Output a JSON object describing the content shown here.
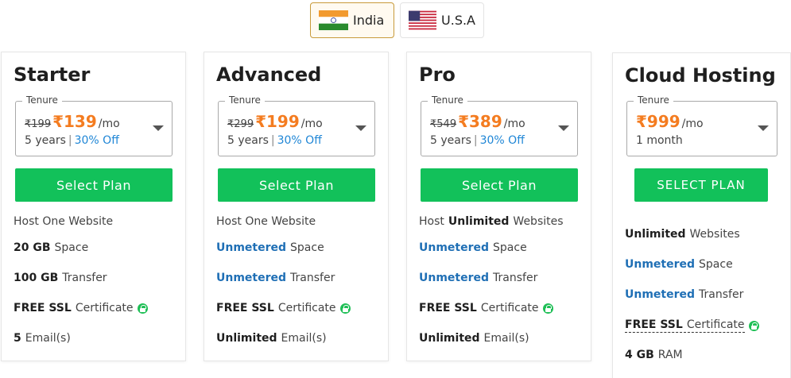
{
  "countries": [
    {
      "label": "India",
      "flag": "india-flag",
      "active": true
    },
    {
      "label": "U.S.A",
      "flag": "usa-flag",
      "active": false
    }
  ],
  "colors": {
    "accent_orange": "#f47c20",
    "button_green": "#12c15a",
    "link_blue": "#1f6fb5",
    "active_border": "#c89a3a"
  },
  "plans": [
    {
      "title": "Starter",
      "tenure_label": "Tenure",
      "old_price": "₹199",
      "new_price": "₹139",
      "per": "/mo",
      "term": "5 years",
      "discount": "30% Off",
      "button": "Select Plan",
      "features": [
        {
          "pre": "Host One Website",
          "strong": "",
          "post": ""
        },
        {
          "pre": "",
          "strong": "20 GB",
          "post": "Space"
        },
        {
          "pre": "",
          "strong": "100 GB",
          "post": "Transfer"
        },
        {
          "pre": "",
          "strong": "FREE SSL",
          "post": "Certificate"
        },
        {
          "pre": "",
          "strong": "5",
          "post": "Email(s)"
        }
      ]
    },
    {
      "title": "Advanced",
      "tenure_label": "Tenure",
      "old_price": "₹299",
      "new_price": "₹199",
      "per": "/mo",
      "term": "5 years",
      "discount": "30% Off",
      "button": "Select Plan",
      "features": [
        {
          "pre": "Host One Website",
          "strong": "",
          "post": ""
        },
        {
          "pre": "",
          "strong": "Unmetered",
          "post": "Space"
        },
        {
          "pre": "",
          "strong": "Unmetered",
          "post": "Transfer"
        },
        {
          "pre": "",
          "strong": "FREE SSL",
          "post": "Certificate"
        },
        {
          "pre": "",
          "strong": "Unlimited",
          "post": "Email(s)"
        }
      ]
    },
    {
      "title": "Pro",
      "tenure_label": "Tenure",
      "old_price": "₹549",
      "new_price": "₹389",
      "per": "/mo",
      "term": "5 years",
      "discount": "30% Off",
      "button": "Select Plan",
      "features": [
        {
          "pre": "Host",
          "strong": "Unlimited",
          "post": "Websites"
        },
        {
          "pre": "",
          "strong": "Unmetered",
          "post": "Space"
        },
        {
          "pre": "",
          "strong": "Unmetered",
          "post": "Transfer"
        },
        {
          "pre": "",
          "strong": "FREE SSL",
          "post": "Certificate"
        },
        {
          "pre": "",
          "strong": "Unlimited",
          "post": "Email(s)"
        }
      ]
    },
    {
      "title": "Cloud Hosting",
      "tenure_label": "Tenure",
      "new_price": "₹999",
      "per": "/mo",
      "term": "1 month",
      "button": "SELECT PLAN",
      "features": [
        {
          "pre": "",
          "strong": "Unlimited",
          "post": "Websites"
        },
        {
          "pre": "",
          "strong": "Unmetered",
          "post": "Space"
        },
        {
          "pre": "",
          "strong": "Unmetered",
          "post": "Transfer"
        },
        {
          "pre": "",
          "strong": "FREE SSL",
          "post": "Certificate"
        },
        {
          "pre": "",
          "strong": "4 GB",
          "post": "RAM"
        }
      ]
    }
  ]
}
